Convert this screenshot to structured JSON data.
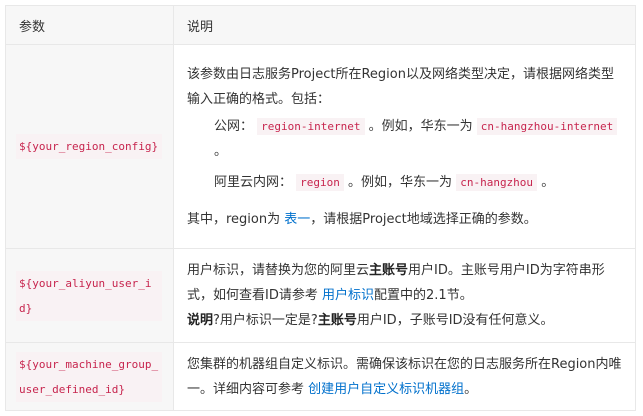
{
  "header": {
    "col_param": "参数",
    "col_desc": "说明"
  },
  "rows": [
    {
      "param": "${your_region_config}",
      "desc_line1": "该参数由日志服务Project所在Region以及网络类型决定，请根据网络类型输入正确的格式。包括：",
      "public_label": "公网：",
      "public_code": "region-internet",
      "public_example": "。例如，华东一为",
      "public_example_code": "cn-hangzhou-internet",
      "public_end": "。",
      "intranet_label": "阿里云内网：",
      "intranet_code": "region",
      "intranet_example": "。例如，华东一为",
      "intranet_example_code": "cn-hangzhou",
      "intranet_end": "。",
      "footer_prefix": "其中，region为",
      "footer_link": "表一",
      "footer_suffix": "，请根据Project地域选择正确的参数。"
    },
    {
      "param": "${your_aliyun_user_id}",
      "desc_prefix": "用户标识，请替换为您的阿里云",
      "desc_bold": "主账号",
      "desc_mid": "用户ID。主账号用户ID为字符串形式，如何查看ID请参考",
      "desc_link": "用户标识",
      "desc_suffix": "配置中的2.1节。",
      "note_label": "说明",
      "note_prefix": "?用户标识一定是?",
      "note_bold": "主账号",
      "note_suffix": "用户ID，子账号ID没有任何意义。"
    },
    {
      "param": "${your_machine_group_user_defined_id}",
      "desc_prefix": "您集群的机器组自定义标识。需确保该标识在您的日志服务所在Region内唯一。详细内容可参考",
      "desc_link": "创建用户自定义标识机器组",
      "desc_suffix": "。"
    }
  ],
  "colors": {
    "code_text": "#c7254e",
    "code_bg": "#f9f2f4",
    "link": "#0070cc",
    "header_bg": "#f7f7f7",
    "border": "#e8e8e8"
  }
}
